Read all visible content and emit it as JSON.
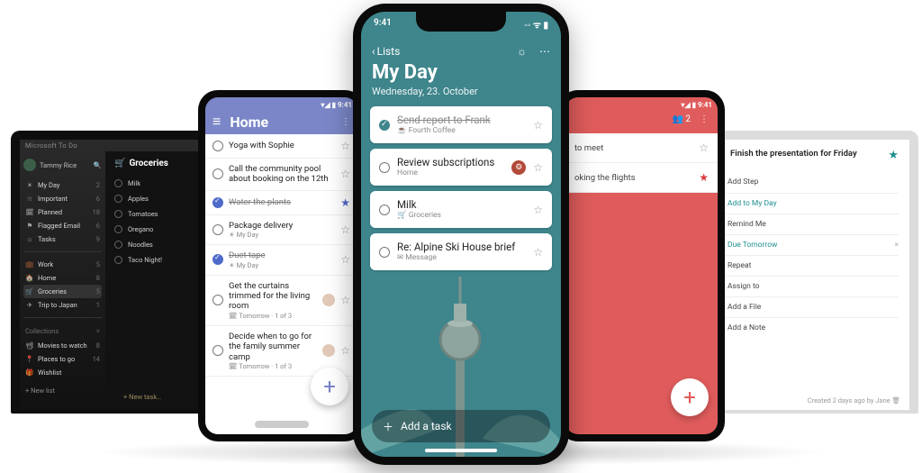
{
  "laptop_dark": {
    "app_title": "Microsoft To Do",
    "user_name": "Tammy Rice",
    "smart_lists": [
      {
        "icon": "☀",
        "label": "My Day",
        "count": "2"
      },
      {
        "icon": "☆",
        "label": "Important",
        "count": "6"
      },
      {
        "icon": "🗓",
        "label": "Planned",
        "count": "18"
      },
      {
        "icon": "⚑",
        "label": "Flagged Email",
        "count": "6"
      },
      {
        "icon": "⌂",
        "label": "Tasks",
        "count": "9"
      }
    ],
    "user_lists": [
      {
        "icon": "💼",
        "label": "Work",
        "count": "5",
        "active": false
      },
      {
        "icon": "🏠",
        "label": "Home",
        "count": "8",
        "active": false
      },
      {
        "icon": "🛒",
        "label": "Groceries",
        "count": "5",
        "active": true
      },
      {
        "icon": "✈",
        "label": "Trip to Japan",
        "count": "1",
        "active": false
      }
    ],
    "collections_label": "Collections",
    "collections": [
      {
        "icon": "📽",
        "label": "Movies to watch",
        "count": "8"
      },
      {
        "icon": "📍",
        "label": "Places to go",
        "count": "14"
      },
      {
        "icon": "🎁",
        "label": "Wishlist",
        "count": ""
      }
    ],
    "new_list_label": "+  New list",
    "main_heading": "Groceries",
    "main_folder_icon": "🛒",
    "items": [
      "Milk",
      "Apples",
      "Tomatoes",
      "Oregano",
      "Noodles",
      "Taco Night!"
    ],
    "add_task_label": "+  New task…"
  },
  "phone_home": {
    "status_time": "▾◢ ▮ 9:41",
    "menu_icon": "≡",
    "title": "Home",
    "more_icon": "⋮",
    "tasks": [
      {
        "main": "Yoga with Sophie",
        "sub": "",
        "done": false,
        "star": false
      },
      {
        "main": "Call the community pool about booking on the 12th",
        "sub": "",
        "done": false,
        "star": false
      },
      {
        "main": "Water the plants",
        "sub": "",
        "done": true,
        "star": true
      },
      {
        "main": "Package delivery",
        "sub": "☀ My Day",
        "done": false,
        "star": false
      },
      {
        "main": "Duct tape",
        "sub": "☀ My Day",
        "done": true,
        "star": false
      },
      {
        "main": "Get the curtains trimmed for the living room",
        "sub": "🗓 Tomorrow · 1 of 3",
        "done": false,
        "star": false,
        "avatar": true
      },
      {
        "main": "Decide when to go for the family summer camp",
        "sub": "🗓 Tomorrow · 1 of 3",
        "done": false,
        "star": false,
        "avatar": true
      }
    ],
    "fab_icon": "+"
  },
  "phone_myday": {
    "status_time": "9:41",
    "status_icons": "◦◦ ᯤ ▮",
    "back_label": "Lists",
    "idea_icon": "☼",
    "more_icon": "⋯",
    "title": "My Day",
    "date": "Wednesday, 23. October",
    "tasks": [
      {
        "main": "Send report to Frank",
        "sub": "☕ Fourth Coffee",
        "done": true
      },
      {
        "main": "Review subscriptions",
        "sub": "Home",
        "done": false,
        "badge": "⚙"
      },
      {
        "main": "Milk",
        "sub": "🛒 Groceries",
        "done": false
      },
      {
        "main": "Re: Alpine Ski House brief",
        "sub": "✉ Message",
        "done": false
      }
    ],
    "add_task_label": "Add a task"
  },
  "phone_red": {
    "status_time": "▾◢ ▮ 9:41",
    "share_label": "👥 2",
    "more_icon": "⋮",
    "tasks": [
      {
        "main": "to meet",
        "star": false
      },
      {
        "main": "oking the flights",
        "star": true
      }
    ],
    "fab_icon": "+"
  },
  "laptop_light": {
    "rail_icons": [
      "≡",
      "—",
      "→"
    ],
    "task_title": "Finish the presentation for Friday",
    "rows": [
      {
        "icon": "＋",
        "label": "Add Step",
        "accent": false
      },
      {
        "icon": "☀",
        "label": "Add to My Day",
        "accent": true
      },
      {
        "icon": "🔔",
        "label": "Remind Me",
        "accent": false
      },
      {
        "icon": "🗓",
        "label": "Due Tomorrow",
        "accent": true,
        "x": true
      },
      {
        "icon": "🔁",
        "label": "Repeat",
        "accent": false
      },
      {
        "icon": "👤",
        "label": "Assign to",
        "accent": false
      },
      {
        "icon": "📎",
        "label": "Add a File",
        "accent": false
      },
      {
        "icon": "",
        "label": "Add a Note",
        "accent": false
      }
    ],
    "footer": "Created 2 days ago by Jane  🗑"
  }
}
